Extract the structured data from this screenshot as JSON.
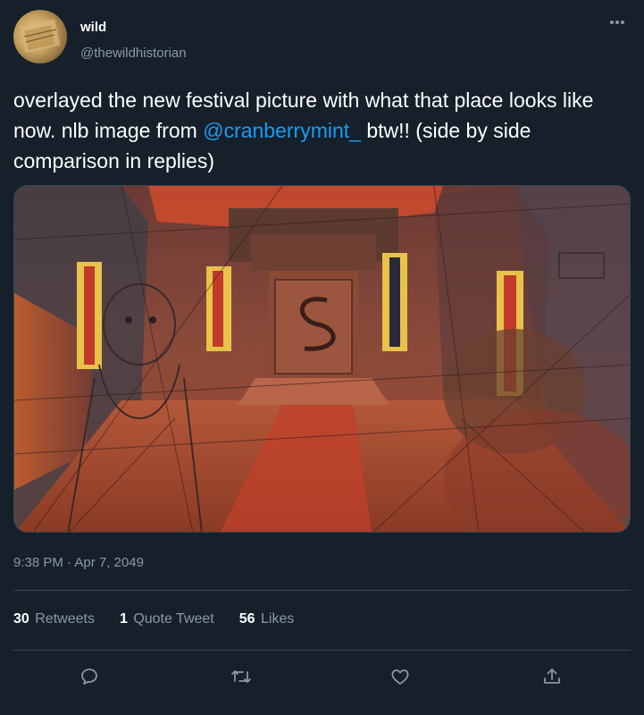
{
  "author": {
    "name": "wild",
    "handle": "@thewildhistorian"
  },
  "tweet": {
    "text_part1": "overlayed the new festival picture with what that place looks like now. nlb image from ",
    "mention": "@cranberrymint_",
    "text_part2": " btw!! (side by side comparison in replies)",
    "timestamp": "9:38 PM · Apr 7, 2049"
  },
  "stats": {
    "retweets_count": "30",
    "retweets_label": "Retweets",
    "quote_count": "1",
    "quote_label": "Quote Tweet",
    "likes_count": "56",
    "likes_label": "Likes"
  },
  "icons": {
    "more": "more-icon",
    "reply": "reply-icon",
    "retweet": "retweet-icon",
    "like": "like-icon",
    "share": "share-icon"
  },
  "colors": {
    "background": "#15202b",
    "accent": "#1d9bf0",
    "secondary_text": "#8b98a5",
    "divider": "#38444d"
  }
}
